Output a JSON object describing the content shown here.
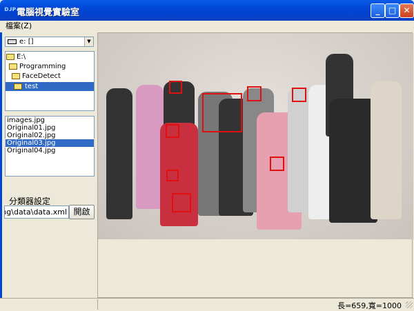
{
  "window": {
    "title": "電腦視覺實驗室",
    "icon_text": "ᴅᴊᴘ"
  },
  "menu": {
    "file": "檔案(Z)"
  },
  "drive": {
    "value": "e: []"
  },
  "tree": [
    {
      "label": "E:\\"
    },
    {
      "label": "Programming"
    },
    {
      "label": "FaceDetect"
    },
    {
      "label": "test",
      "selected": true
    }
  ],
  "files": [
    "images.jpg",
    "Original01.jpg",
    "Original02.jpg",
    "Original03.jpg",
    "Original04.jpg"
  ],
  "selected_file": "Original03.jpg",
  "classifier": {
    "label": "分類器設定",
    "path": "ng\\data\\data.xml",
    "open_button": "開啟"
  },
  "status": {
    "dimensions": "長=659,寬=1000"
  },
  "detection_color": "#e01010"
}
